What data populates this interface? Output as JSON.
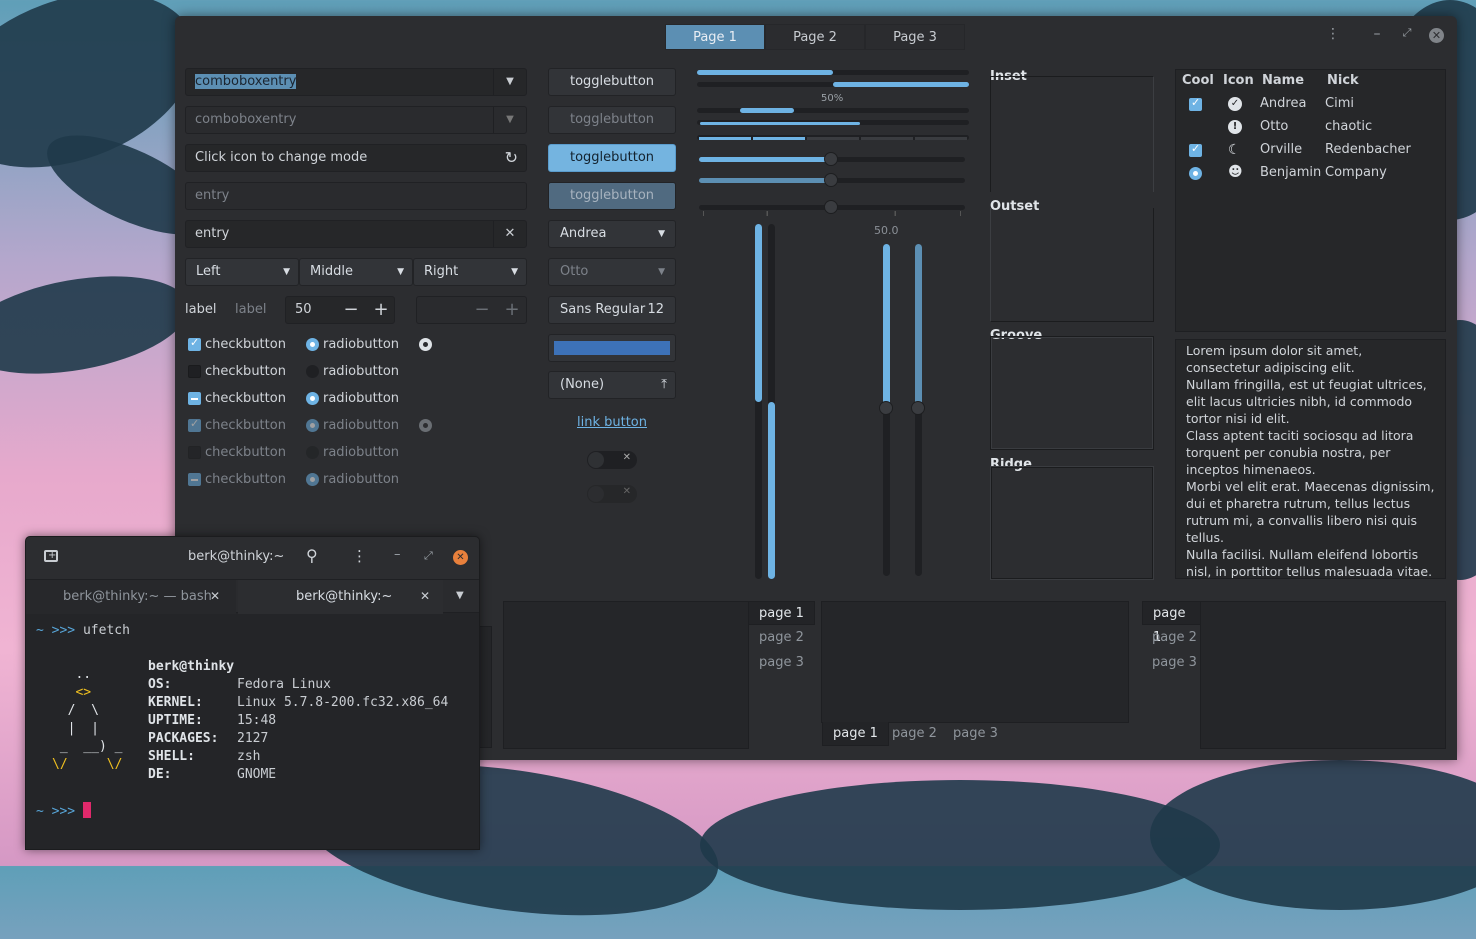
{
  "window": {
    "tabs": [
      "Page 1",
      "Page 2",
      "Page 3"
    ],
    "selected_tab": 0
  },
  "col1": {
    "combo1": "comboboxentry",
    "combo2": "comboboxentry",
    "mode_entry_placeholder": "Click icon to change mode",
    "entry_placeholder": "entry",
    "entry_value": "entry",
    "combos": [
      "Left",
      "Middle",
      "Right"
    ],
    "label1": "label",
    "label2": "label",
    "spin_value": "50",
    "checks": [
      "checkbutton",
      "checkbutton",
      "checkbutton",
      "checkbutton",
      "checkbutton",
      "checkbutton"
    ],
    "radios": [
      "radiobutton",
      "radiobutton",
      "radiobutton",
      "radiobutton",
      "radiobutton",
      "radiobutton"
    ]
  },
  "col2": {
    "toggles": [
      "togglebutton",
      "togglebutton",
      "togglebutton",
      "togglebutton"
    ],
    "combo_a": "Andrea",
    "combo_b": "Otto",
    "font_name": "Sans Regular",
    "font_size": "12",
    "file_none": "(None)",
    "link": "link button"
  },
  "sliders": {
    "progress_label": "50%",
    "scale_value": "50.0",
    "progress1": 0.48,
    "progress2": 0.58,
    "hscale1": 0.5,
    "hscale2": 0.5,
    "hscale3": 0.5,
    "vscale1": 0.5,
    "vscale2": 0.5
  },
  "frames": [
    "Inset",
    "Outset",
    "Groove",
    "Ridge"
  ],
  "tree": {
    "headers": [
      "Cool",
      "Icon",
      "Name",
      "Nick"
    ],
    "rows": [
      {
        "cool": "check",
        "icon": "check-circle-icon",
        "name": "Andrea",
        "nick": "Cimi"
      },
      {
        "cool": "none",
        "icon": "alert-circle-icon",
        "name": "Otto",
        "nick": "chaotic"
      },
      {
        "cool": "check",
        "icon": "moon-icon",
        "name": "Orville",
        "nick": "Redenbacher"
      },
      {
        "cool": "radio",
        "icon": "face-icon",
        "name": "Benjamin",
        "nick": "Company"
      }
    ]
  },
  "text": [
    "Lorem ipsum dolor sit amet,",
    "consectetur adipiscing elit.",
    "Nullam fringilla, est ut feugiat ultrices,",
    "elit lacus ultricies nibh, id commodo",
    "tortor nisi id elit.",
    "Class aptent taciti sociosqu ad litora",
    "torquent per conubia nostra, per",
    "inceptos himenaeos.",
    "Morbi vel elit erat. Maecenas dignissim,",
    "dui et pharetra rutrum, tellus lectus",
    "rutrum mi, a convallis libero nisi quis",
    "tellus.",
    "Nulla facilisi. Nullam eleifend lobortis",
    "nisl, in porttitor tellus malesuada vitae."
  ],
  "notebooks": {
    "pages": [
      "page 1",
      "page 2",
      "page 3"
    ]
  },
  "terminal": {
    "title": "berk@thinky:~",
    "tab1": "berk@thinky:~ — bash",
    "tab2": "berk@thinky:~",
    "prompt": "~ >>>",
    "command": "ufetch",
    "user_host": "berk@thinky",
    "info": [
      {
        "key": "OS:",
        "value": "Fedora Linux"
      },
      {
        "key": "KERNEL:",
        "value": "Linux 5.7.8-200.fc32.x86_64"
      },
      {
        "key": "UPTIME:",
        "value": "15:48"
      },
      {
        "key": "PACKAGES:",
        "value": "2127"
      },
      {
        "key": "SHELL:",
        "value": "zsh"
      },
      {
        "key": "DE:",
        "value": "GNOME"
      }
    ],
    "tux": [
      "   ..",
      "   <>",
      "  /  \\",
      "  |  |",
      " _  __) _",
      "\\/     \\/"
    ]
  },
  "colors": {
    "accent": "#6eb3e4",
    "prompt_pink": "#e0296b",
    "tux_yellow": "#f0c020"
  }
}
